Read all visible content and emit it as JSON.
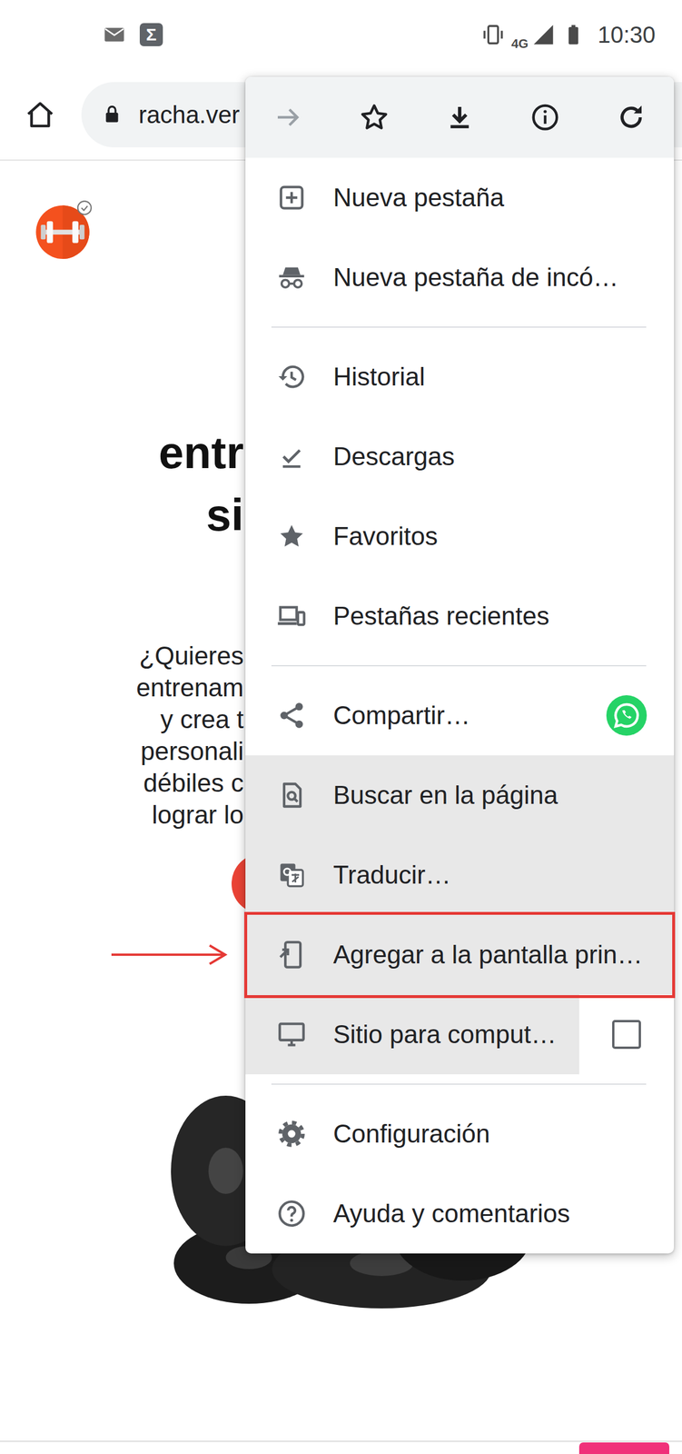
{
  "status_bar": {
    "app_icon": "Σ",
    "network": "4G",
    "time": "10:30"
  },
  "address_bar": {
    "url": "racha.ver"
  },
  "page": {
    "heading": [
      "entr",
      "si"
    ],
    "body": [
      "¿Quieres",
      "entrenam",
      "y crea t",
      "personali",
      "débiles c",
      "lograr lo"
    ]
  },
  "menu": {
    "toolbar": [
      {
        "disabled": true
      },
      {
        "disabled": false
      },
      {
        "disabled": false
      },
      {
        "disabled": false
      },
      {
        "disabled": false
      }
    ],
    "groups": [
      [
        {
          "label": "Nueva pestaña",
          "kind": "plain",
          "highlighted": false,
          "annotated": false
        },
        {
          "label": "Nueva pestaña de incó…",
          "kind": "plain",
          "highlighted": false,
          "annotated": false
        }
      ],
      [
        {
          "label": "Historial",
          "kind": "plain",
          "highlighted": false,
          "annotated": false
        },
        {
          "label": "Descargas",
          "kind": "plain",
          "highlighted": false,
          "annotated": false
        },
        {
          "label": "Favoritos",
          "kind": "plain",
          "highlighted": false,
          "annotated": false
        },
        {
          "label": "Pestañas recientes",
          "kind": "plain",
          "highlighted": false,
          "annotated": false
        }
      ],
      [
        {
          "label": "Compartir…",
          "kind": "share",
          "highlighted": false,
          "annotated": false
        },
        {
          "label": "Buscar en la página",
          "kind": "plain",
          "highlighted": true,
          "annotated": false
        },
        {
          "label": "Traducir…",
          "kind": "plain",
          "highlighted": true,
          "annotated": false
        },
        {
          "label": "Agregar a la pantalla prin…",
          "kind": "plain",
          "highlighted": true,
          "annotated": true
        },
        {
          "label": "Sitio para comput…",
          "kind": "checkbox",
          "highlighted": true,
          "annotated": false,
          "checked": false
        }
      ],
      [
        {
          "label": "Configuración",
          "kind": "plain",
          "highlighted": false,
          "annotated": false
        },
        {
          "label": "Ayuda y comentarios",
          "kind": "plain",
          "highlighted": false,
          "annotated": false
        }
      ]
    ]
  }
}
